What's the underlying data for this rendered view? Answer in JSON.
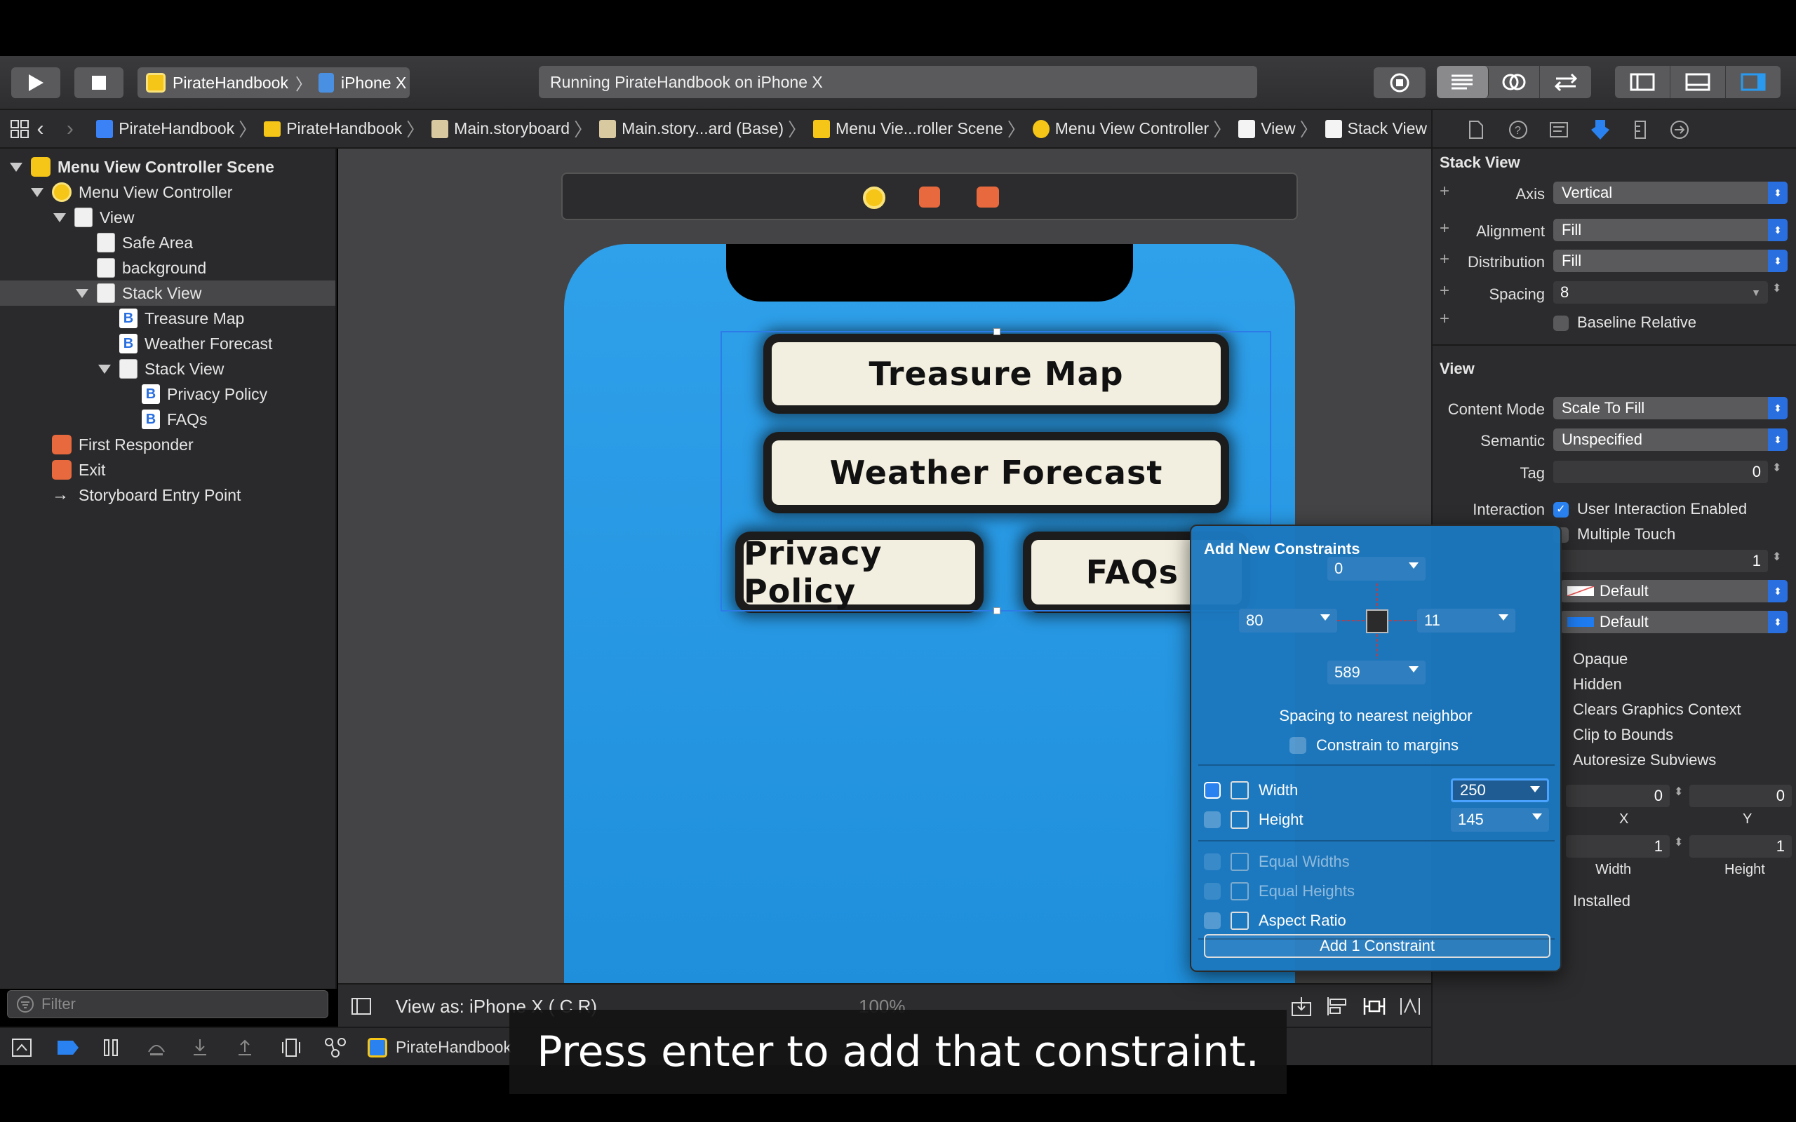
{
  "toolbar": {
    "scheme_app": "PirateHandbook",
    "scheme_device": "iPhone X",
    "activity": "Running PirateHandbook on iPhone X"
  },
  "breadcrumbs": [
    "PirateHandbook",
    "PirateHandbook",
    "Main.storyboard",
    "Main.story...ard (Base)",
    "Menu Vie...roller Scene",
    "Menu View Controller",
    "View",
    "Stack View"
  ],
  "navigator": {
    "items": [
      {
        "label": "Menu View Controller Scene"
      },
      {
        "label": "Menu View Controller"
      },
      {
        "label": "View"
      },
      {
        "label": "Safe Area"
      },
      {
        "label": "background"
      },
      {
        "label": "Stack View"
      },
      {
        "label": "Treasure Map"
      },
      {
        "label": "Weather Forecast"
      },
      {
        "label": "Stack View"
      },
      {
        "label": "Privacy Policy"
      },
      {
        "label": "FAQs"
      },
      {
        "label": "First Responder"
      },
      {
        "label": "Exit"
      },
      {
        "label": "Storyboard Entry Point"
      }
    ],
    "filter_placeholder": "Filter"
  },
  "canvas": {
    "buttons": {
      "treasure_map": "Treasure Map",
      "weather_forecast": "Weather Forecast",
      "privacy_policy": "Privacy Policy",
      "faqs": "FAQs"
    },
    "view_as": "View as: iPhone X ( C  R)",
    "zoom": "100%"
  },
  "debug_bar": {
    "app": "PirateHandbook"
  },
  "inspector": {
    "stack_view_header": "Stack View",
    "axis_label": "Axis",
    "axis_value": "Vertical",
    "alignment_label": "Alignment",
    "alignment_value": "Fill",
    "distribution_label": "Distribution",
    "distribution_value": "Fill",
    "spacing_label": "Spacing",
    "spacing_value": "8",
    "baseline_label": "Baseline Relative",
    "view_header": "View",
    "content_mode_label": "Content Mode",
    "content_mode_value": "Scale To Fill",
    "semantic_label": "Semantic",
    "semantic_value": "Unspecified",
    "tag_label": "Tag",
    "tag_value": "0",
    "interaction_label": "Interaction",
    "user_interaction": "User Interaction Enabled",
    "multiple_touch": "Multiple Touch",
    "alpha_value": "1",
    "background_value": "Default",
    "tint_value": "Default",
    "opaque": "Opaque",
    "hidden": "Hidden",
    "clears_context": "Clears Graphics Context",
    "clip_bounds": "Clip to Bounds",
    "autoresize": "Autoresize Subviews",
    "x_value": "0",
    "y_value": "0",
    "x_label": "X",
    "y_label": "Y",
    "width_value": "1",
    "height_value": "1",
    "width_label": "Width",
    "height_label": "Height",
    "installed": "Installed"
  },
  "constraints_popover": {
    "title": "Add New Constraints",
    "top": "0",
    "leading": "80",
    "trailing": "11",
    "bottom": "589",
    "spacing_caption": "Spacing to nearest neighbor",
    "constrain_margins": "Constrain to margins",
    "width_label": "Width",
    "width_value": "250",
    "height_label": "Height",
    "height_value": "145",
    "equal_widths": "Equal Widths",
    "equal_heights": "Equal Heights",
    "aspect_ratio": "Aspect Ratio",
    "add_button": "Add 1 Constraint"
  },
  "caption": "Press enter to add that constraint.",
  "colors": {
    "accent": "#2a82f0",
    "phone_bg": "#2fa0ea",
    "popover_bg": "#1c78be"
  }
}
